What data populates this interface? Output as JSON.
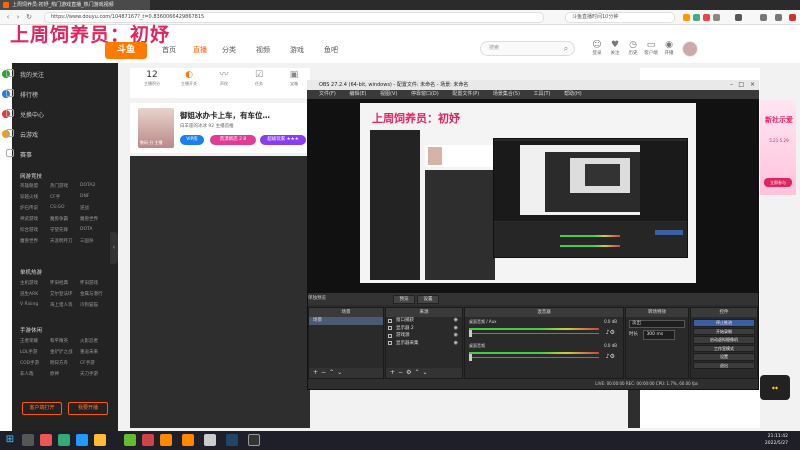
{
  "browser": {
    "tab_title": "上周饲养员:初妤_热门游戏直播_热门游戏视频",
    "url": "https://www.douyu.com/10487167?_t=0.8360066429867815",
    "search_placeholder": "斗鱼直播时间10分钟"
  },
  "site": {
    "overlay_title": "上周饲养员：初妤",
    "logo": "斗鱼",
    "nav": [
      "首页",
      "直播",
      "分类",
      "视频",
      "游戏",
      "鱼吧"
    ],
    "active_nav": "直播",
    "search_placeholder": "搜索",
    "top_icons": [
      "登录",
      "关注",
      "历史",
      "客户端",
      "开播"
    ],
    "stats": [
      {
        "num": "12",
        "label": "主播积分"
      },
      {
        "label": "主播开关"
      },
      {
        "label": "声纹"
      },
      {
        "label": "任务"
      },
      {
        "label": "宝箱"
      }
    ],
    "room": {
      "title": "御姐冰办卡上车，有车位…",
      "meta": "白羊座的冰冰  92  主播首推",
      "tags": [
        "VIP房",
        "荒漠新店 2 8",
        "超级玩家 ★★★"
      ],
      "avatar_name": "数码 分 主播"
    }
  },
  "sidebar": {
    "items": [
      {
        "label": "我的关注"
      },
      {
        "label": "排行榜"
      },
      {
        "label": "兑换中心"
      },
      {
        "label": "云游戏"
      },
      {
        "label": "赛事"
      }
    ],
    "section1": "网游竞技",
    "section1_items": [
      "英雄联盟",
      "热门游戏",
      "DOTA2",
      "穿越火线",
      "CF手",
      "DNF",
      "炉石传说",
      "CS:GO",
      "逆战",
      "神武游戏",
      "魔兽争霸",
      "魔兽世界",
      "综合游戏",
      "守望先锋",
      "DOTA",
      "魔兽世界",
      "天涯明月刀",
      "三国杀"
    ],
    "section2": "单机热游",
    "section2_items": [
      "主机游戏",
      "怀旧经典",
      "怀旧游戏",
      "逃生ARK",
      "艾尔登法环",
      "金属与潜行",
      "V Rising",
      "海上猎人等",
      "冷狗猫猫"
    ],
    "section3": "手游休闲",
    "section3_items": [
      "王者荣耀",
      "和平精英",
      "火影忍者",
      "LOL手游",
      "金铲铲之战",
      "重返未来",
      "COD手游",
      "明日方舟",
      "CF手游",
      "非人哉",
      "原神",
      "天刀手游"
    ],
    "btn_client": "客户端打开",
    "btn_stream": "我要开播"
  },
  "obs": {
    "title": "OBS 27.2.4 (64-bit, windows) - 配置文件: 未命名 - 场景: 未命名",
    "menu": [
      "文件(F)",
      "编辑(E)",
      "视图(V)",
      "停靠窗口(D)",
      "配置文件(P)",
      "场景集合(S)",
      "工具(T)",
      "帮助(H)"
    ],
    "preview_label": "单独预览",
    "toolbar_buttons": [
      "预览",
      "设置"
    ],
    "scenes": {
      "title": "场景",
      "items": [
        "场景"
      ]
    },
    "sources": {
      "title": "来源",
      "items": [
        "窗口捕获",
        "显示器 2",
        "游戏源",
        "显示器采集"
      ]
    },
    "mixer": {
      "title": "混音器",
      "channels": [
        {
          "name": "桌面音频 / Aux",
          "db": "0.0 dB",
          "level_pct": 80
        },
        {
          "name": "桌面音频",
          "db": "0.0 dB",
          "level_pct": 80
        }
      ]
    },
    "transitions": {
      "title": "转场特效",
      "type": "淡出",
      "duration_label": "时长",
      "duration": "300 ms"
    },
    "controls": {
      "title": "控件",
      "buttons": [
        "停止推流",
        "开始录制",
        "启动虚拟摄像机",
        "工作室模式",
        "设置",
        "退出"
      ]
    },
    "status": "LIVE: 00:00:00   REC: 00:00:00   CPU: 1.7%, 60.00 fps"
  },
  "nested": {
    "title": "上周饲养员：初妤"
  },
  "promo": {
    "title": "新社示爱",
    "date": "5.21-5.29",
    "button": "立即参与"
  },
  "taskbar": {
    "time": "21:11:42",
    "date": "2022/5/27"
  },
  "colors": {
    "brand": "#ff7a00",
    "overlay_pink": "#e0245e",
    "obs_dark": "#2b2b2b",
    "live_blue": "#3b5fa3"
  }
}
